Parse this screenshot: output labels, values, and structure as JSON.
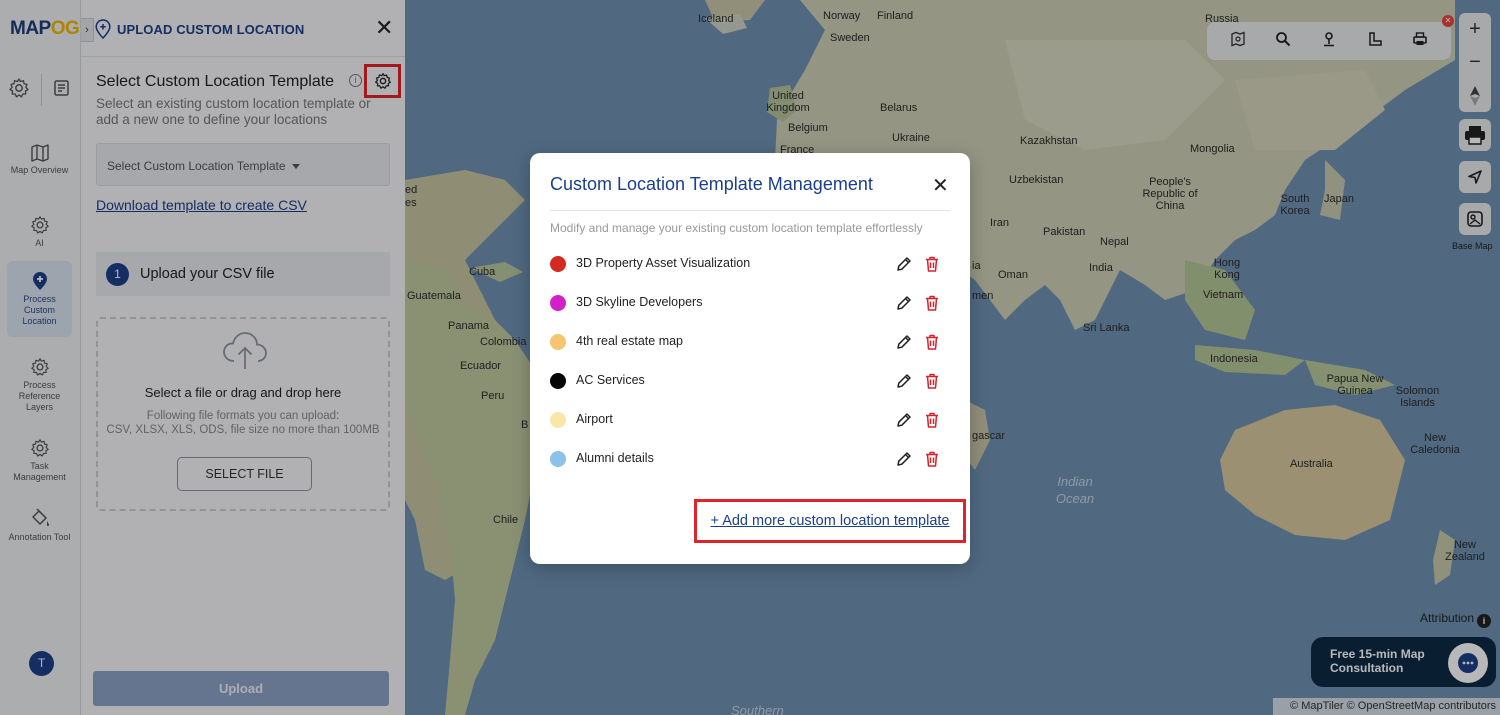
{
  "app": {
    "logo_main": "MAP",
    "logo_accent": "OG"
  },
  "rail": {
    "items": [
      {
        "label": "Map Overview"
      },
      {
        "label": "AI"
      },
      {
        "label": "Process Custom Location"
      },
      {
        "label": "Process Reference Layers"
      },
      {
        "label": "Task Management"
      },
      {
        "label": "Annotation Tool"
      }
    ],
    "avatar_initial": "T"
  },
  "panel": {
    "title": "UPLOAD CUSTOM LOCATION",
    "section_title": "Select Custom Location Template",
    "section_desc": "Select an existing custom location template or add a new one to define your locations",
    "select_placeholder": "Select Custom Location Template",
    "download_link": "Download template to create CSV",
    "step_number": "1",
    "step_label": "Upload your CSV file",
    "dropzone_title": "Select a file or drag and drop here",
    "dropzone_sub_1": "Following file formats you can upload:",
    "dropzone_sub_2": "CSV, XLSX, XLS, ODS, file size no more than 100MB",
    "select_file_label": "SELECT FILE",
    "upload_label": "Upload"
  },
  "modal": {
    "title": "Custom Location Template Management",
    "description": "Modify and manage your existing custom location template effortlessly",
    "templates": [
      {
        "name": "3D Property Asset Visualization",
        "color": "#d42a22"
      },
      {
        "name": "3D Skyline Developers",
        "color": "#d321c9"
      },
      {
        "name": "4th real estate map",
        "color": "#f6c56f"
      },
      {
        "name": "AC Services",
        "color": "#050505"
      },
      {
        "name": "Airport",
        "color": "#f8e7a6"
      },
      {
        "name": "Alumni details",
        "color": "#8cc1ea"
      }
    ],
    "add_more_label": "+ Add more custom location template"
  },
  "map": {
    "labels": {
      "iceland": "Iceland",
      "norway": "Norway",
      "finland": "Finland",
      "sweden": "Sweden",
      "russia": "Russia",
      "uk": "United Kingdom",
      "belarus": "Belarus",
      "belgium": "Belgium",
      "ukraine": "Ukraine",
      "france": "France",
      "kazakhstan": "Kazakhstan",
      "mongolia": "Mongolia",
      "uzbekistan": "Uzbekistan",
      "china": "People's Republic of China",
      "southkorea": "South Korea",
      "japan": "Japan",
      "iran": "Iran",
      "pakistan": "Pakistan",
      "nepal": "Nepal",
      "india": "India",
      "hongkong": "Hong Kong",
      "oman": "Oman",
      "vietnam": "Vietnam",
      "srilanka": "Sri Lanka",
      "indonesia": "Indonesia",
      "png": "Papua New Guinea",
      "solomon": "Solomon Islands",
      "australia": "Australia",
      "caledonia": "New Caledonia",
      "newzealand": "New Zealand",
      "cuba": "Cuba",
      "guatemala": "Guatemala",
      "panama": "Panama",
      "colombia": "Colombia",
      "ecuador": "Ecuador",
      "peru": "Peru",
      "chile": "Chile",
      "madagascar": "gascar",
      "yemen": "men",
      "arabia": "ia",
      "indian_ocean": "Indian Ocean",
      "southern": "Southern",
      "edge1": "ed",
      "edge2": "es",
      "edgeb": "B"
    },
    "base_map_label": "Base Map",
    "attribution_label": "Attribution",
    "copyright": "© MapTiler © OpenStreetMap contributors",
    "consult_line1": "Free 15-min Map",
    "consult_line2": "Consultation"
  }
}
